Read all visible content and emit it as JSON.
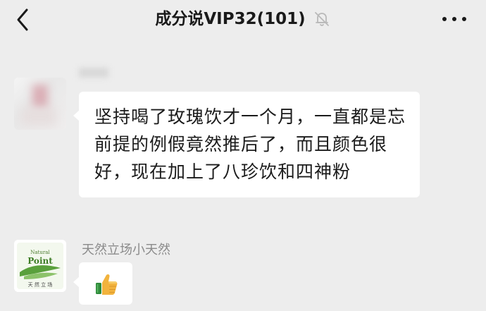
{
  "header": {
    "title": "成分说VIP32(101)",
    "back_icon": "chevron-left-icon",
    "mute_icon": "bell-off-icon",
    "more_icon": "more-dots-icon"
  },
  "messages": [
    {
      "sender": "",
      "text": "坚持喝了玫瑰饮才一个月，一直都是忘前提的例假竟然推后了，而且颜色很好，现在加上了八珍饮和四神粉"
    },
    {
      "sender": "天然立场小天然",
      "content_icon": "thumbs-up-emoji",
      "avatar_text_top": "Natural",
      "avatar_text_main": "Point",
      "avatar_text_bottom": "天 然 立 场"
    }
  ],
  "colors": {
    "background": "#ededed",
    "bubble": "#ffffff",
    "title": "#1a1a1a",
    "sender": "#8b8b8b",
    "logo_green": "#5aa03c"
  }
}
